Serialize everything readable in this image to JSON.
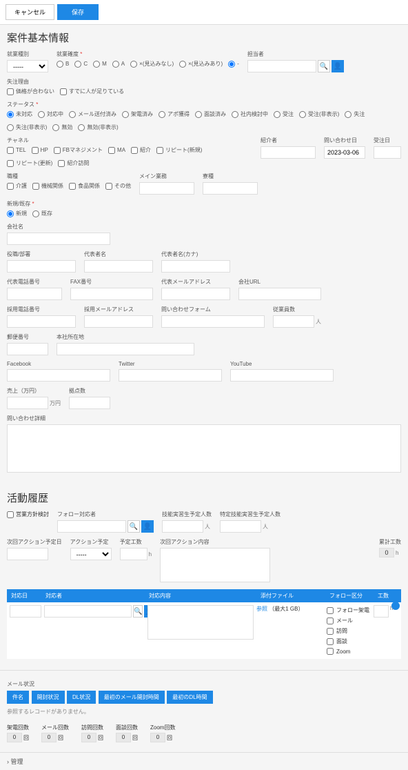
{
  "topbar": {
    "cancel": "キャンセル",
    "save": "保存"
  },
  "sections": {
    "basic": "案件基本情報",
    "activity": "活動履歴",
    "admin": "管理"
  },
  "basic": {
    "bizType": "就業種別",
    "bizKakudo": "就業確度",
    "radios_kakudo": [
      "B",
      "C",
      "M",
      "A",
      "×(見込みなし)",
      "×(見込みあり)",
      "-"
    ],
    "tantou": "担当者",
    "lostReason": "失注理由",
    "lostOpts": [
      "価格が合わない",
      "すでに人が足りている"
    ],
    "status": "ステータス",
    "statusOpts": [
      "未対応",
      "対応中",
      "メール送付済み",
      "架電済み",
      "アポ獲得",
      "面談済み",
      "社内検討中",
      "受注",
      "受注(非表示)",
      "失注",
      "失注(非表示)",
      "無効",
      "無効(非表示)"
    ],
    "channel": "チャネル",
    "channelOpts": [
      "TEL",
      "HP",
      "FBマネジメント",
      "MA",
      "紹介",
      "リピート(新規)",
      "リピート(更新)",
      "紹介訪問"
    ],
    "introducer": "紹介者",
    "inquiryDate": "問い合わせ日",
    "inquiryDateVal": "2023-03-06",
    "orderDate": "受注日",
    "occupation": "職種",
    "occOpts": [
      "介護",
      "機械関係",
      "食品関係",
      "その他"
    ],
    "mainBiz": "メイン業務",
    "ryou": "寮種",
    "newExist": "新規/既存",
    "neOpts": [
      "新規",
      "既存"
    ],
    "company": "会社名",
    "position": "役職/部署",
    "repName": "代表者名",
    "repKana": "代表者名(カナ)",
    "repTel": "代表電話番号",
    "fax": "FAX番号",
    "repMail": "代表メールアドレス",
    "url": "会社URL",
    "adoptTel": "採用電話番号",
    "adoptMail": "採用メールアドレス",
    "inquiryForm": "問い合わせフォーム",
    "employees": "従業員数",
    "empSuffix": "人",
    "zip": "郵便番号",
    "address": "本社所在地",
    "fb": "Facebook",
    "tw": "Twitter",
    "yt": "YouTube",
    "sales": "売上（万円）",
    "salesSuffix": "万円",
    "bases": "拠点数",
    "inquiryDetail": "問い合わせ詳細"
  },
  "activity": {
    "policyCheck": "営業方針検討",
    "followTarget": "フォロー対応者",
    "skillReq": "技能実習生予定人数",
    "specSkillReq": "特定技能実習生予定人数",
    "suffix": "人",
    "nextDate": "次回アクション予定日",
    "actionPlan": "アクション予定",
    "estHours": "予定工数",
    "estSuffix": "h",
    "nextAction": "次回アクション内容",
    "totalHours": "累計工数",
    "totalVal": "0",
    "totalSuffix": "h",
    "table": {
      "date": "対応日",
      "person": "対応者",
      "content": "対応内容",
      "file": "添付ファイル",
      "followCat": "フォロー区分",
      "hours": "工数"
    },
    "fileBtn": "参照",
    "fileNote": "（最大1 GB）",
    "hSuffix": "h",
    "followOpts": [
      "フォロー架電",
      "メール",
      "訪問",
      "面談",
      "Zoom"
    ]
  },
  "mail": {
    "title": "メール状況",
    "tabs": [
      "件名",
      "開封状況",
      "DL状況",
      "最初のメール開封時間",
      "最初のDL時間"
    ],
    "noRecord": "参照するレコードがありません。",
    "counts": [
      "架電回数",
      "メール回数",
      "訪問回数",
      "面談回数",
      "Zoom回数"
    ],
    "countVal": "0",
    "countSuffix": "回"
  }
}
